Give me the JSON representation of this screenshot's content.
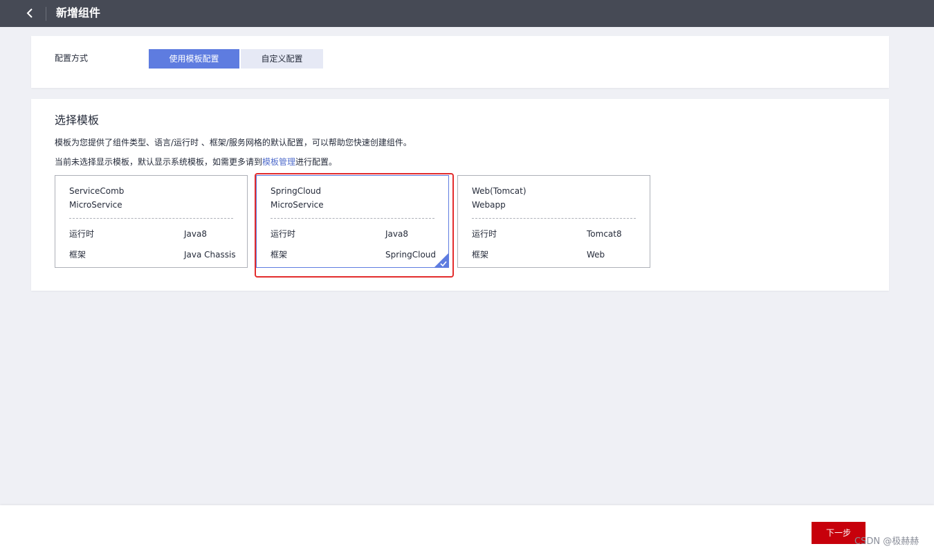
{
  "header": {
    "back_icon": "chevron-left-icon",
    "title": "新增组件"
  },
  "config_mode": {
    "label": "配置方式",
    "tabs": [
      {
        "label": "使用模板配置",
        "active": true
      },
      {
        "label": "自定义配置",
        "active": false
      }
    ]
  },
  "template_section": {
    "title": "选择模板",
    "desc_line1": "模板为您提供了组件类型、语言/运行时 、框架/服务网格的默认配置，可以帮助您快速创建组件。",
    "desc_line2_prefix": "当前未选择显示模板，默认显示系统模板，如需更多请到",
    "desc_line2_link": "模板管理",
    "desc_line2_suffix": "进行配置。",
    "templates": [
      {
        "name_line1": "ServiceComb",
        "name_line2": "MicroService",
        "runtime_label": "运行时",
        "runtime_value": "Java8",
        "framework_label": "框架",
        "framework_value": "Java Chassis",
        "selected": false
      },
      {
        "name_line1": "SpringCloud",
        "name_line2": "MicroService",
        "runtime_label": "运行时",
        "runtime_value": "Java8",
        "framework_label": "框架",
        "framework_value": "SpringCloud",
        "selected": true
      },
      {
        "name_line1": "Web(Tomcat)",
        "name_line2": "Webapp",
        "runtime_label": "运行时",
        "runtime_value": "Tomcat8",
        "framework_label": "框架",
        "framework_value": "Web",
        "selected": false
      }
    ]
  },
  "footer": {
    "next_label": "下一步",
    "watermark": "CSDN @极赫赫"
  },
  "colors": {
    "topbar": "#464a55",
    "accent": "#5e7ce0",
    "primary_button": "#c7000b",
    "highlight": "#e32c2c",
    "link": "#526ecc"
  }
}
